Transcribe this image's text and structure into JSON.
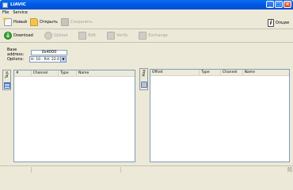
{
  "window": {
    "title": "LIAVIC",
    "min": "_",
    "max": "□",
    "close": "×"
  },
  "menu": [
    "File",
    "Service"
  ],
  "toolbar": {
    "new_label": "Новый",
    "open_label": "Открыть",
    "save_label": "Сохранить",
    "options_label": "Опции"
  },
  "actions": {
    "download_label": "Download",
    "upload_label": "Upload",
    "edit_label": "Edit",
    "verify_label": "Verify",
    "exchange_label": "Exchange"
  },
  "form": {
    "base_address_label": "Base address:",
    "base_address_value": "0x4000",
    "options_label": "Options:",
    "options_value": "H: 10 - RH: 22.0"
  },
  "left_panel": {
    "tab_label": "Tags",
    "columns": [
      "#",
      "Channel",
      "Type",
      "Name"
    ]
  },
  "right_panel": {
    "tab_label": "Map",
    "columns": [
      "Offset",
      "Type",
      "Channel",
      "Name"
    ]
  }
}
